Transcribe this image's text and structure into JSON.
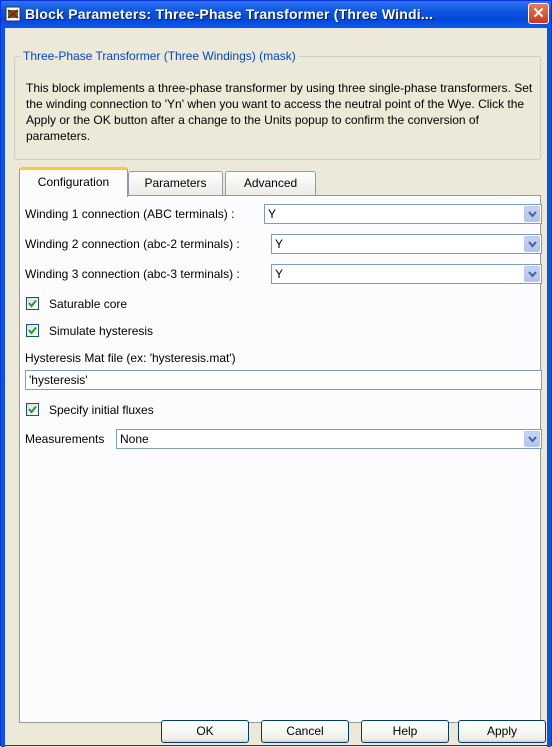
{
  "window": {
    "title": "Block Parameters: Three-Phase Transformer (Three Windi...",
    "close_glyph": "✕"
  },
  "mask": {
    "legend": "Three-Phase Transformer (Three Windings) (mask)",
    "description": "This block implements a three-phase transformer by using three single-phase transformers. Set the winding connection to 'Yn' when you want to access the neutral point of the Wye. Click the Apply or the OK button after a change to the Units popup to confirm the conversion of parameters."
  },
  "tabs": [
    {
      "label": "Configuration",
      "active": true
    },
    {
      "label": "Parameters",
      "active": false
    },
    {
      "label": "Advanced",
      "active": false
    }
  ],
  "config": {
    "winding1": {
      "label": "Winding 1 connection (ABC terminals) :",
      "value": "Y"
    },
    "winding2": {
      "label": "Winding 2 connection (abc-2 terminals) :",
      "value": "Y"
    },
    "winding3": {
      "label": "Winding 3 connection (abc-3 terminals) :",
      "value": "Y"
    },
    "saturable_core": {
      "label": "Saturable core",
      "checked": true
    },
    "simulate_hysteresis": {
      "label": "Simulate hysteresis",
      "checked": true
    },
    "hysteresis_file": {
      "label": "Hysteresis Mat file (ex: 'hysteresis.mat')",
      "value": "'hysteresis'"
    },
    "initial_fluxes": {
      "label": "Specify initial fluxes",
      "checked": true
    },
    "measurements": {
      "label": "Measurements",
      "value": "None"
    }
  },
  "buttons": {
    "ok": "OK",
    "cancel": "Cancel",
    "help": "Help",
    "apply": "Apply"
  },
  "colors": {
    "titlebar": "#0a55e0",
    "accent_tab": "#ffc83c",
    "legend_text": "#0046d5",
    "dialog_bg": "#ece9d8"
  }
}
